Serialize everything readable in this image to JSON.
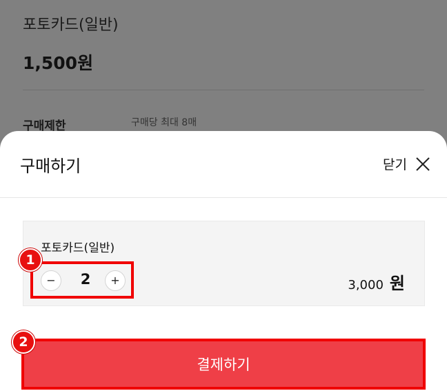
{
  "background_page": {
    "product_title": "포토카드(일반)",
    "price": "1,500원",
    "purchase_limit_label": "구매제한",
    "purchase_limit_value": "구매당 최대 8매"
  },
  "sheet": {
    "title": "구매하기",
    "close_label": "닫기",
    "close_icon": "close-icon",
    "item": {
      "name": "포토카드(일반)",
      "quantity": "2",
      "minus_symbol": "−",
      "plus_symbol": "+",
      "total_amount": "3,000",
      "total_unit": "원"
    },
    "pay_button_label": "결제하기"
  },
  "annotations": {
    "badge_1": "1",
    "badge_2": "2"
  },
  "colors": {
    "accent_red": "#ef3f47",
    "highlight_border": "#f00000",
    "overlay_gray": "#808080"
  }
}
